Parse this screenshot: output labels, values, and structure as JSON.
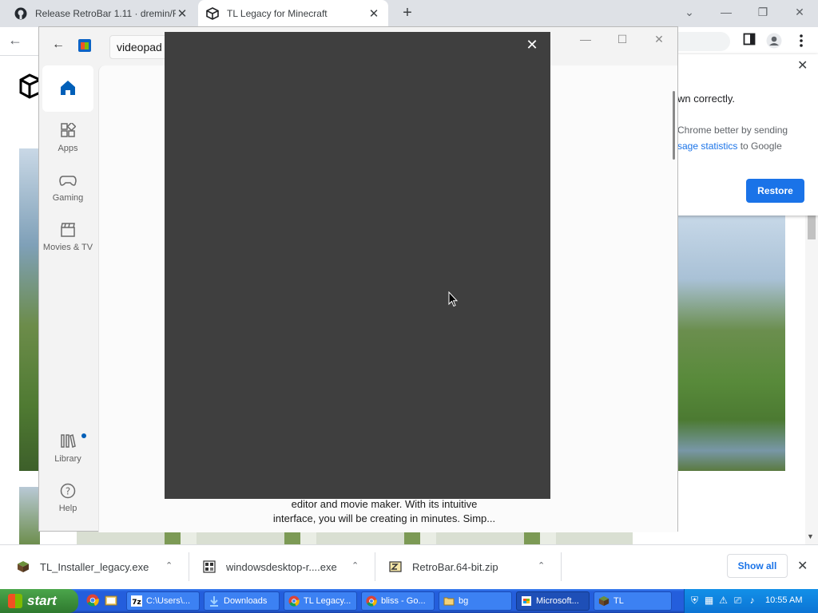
{
  "browser": {
    "tabs": [
      {
        "title": "Release RetroBar 1.11 · dremin/R",
        "icon": "github-icon"
      },
      {
        "title": "TL Legacy for Minecraft",
        "icon": "tl-cube-icon"
      }
    ],
    "new_tab": "+",
    "window_controls": {
      "dropdown": "⌄",
      "minimize": "—",
      "restore": "❐",
      "close": "✕"
    }
  },
  "infobar": {
    "text_line1": "wn correctly.",
    "text_line2": "Chrome better by sending",
    "link": "sage statistics",
    "text_line3_tail": " to Google",
    "restore_label": "Restore",
    "close": "✕"
  },
  "store": {
    "search_value": "videopad",
    "window_controls": {
      "minimize": "—",
      "maximize": "☐",
      "close": "✕"
    },
    "nav": [
      {
        "label": "",
        "icon": "home-icon"
      },
      {
        "label": "Apps",
        "icon": "apps-icon"
      },
      {
        "label": "Gaming",
        "icon": "gamepad-icon"
      },
      {
        "label": "Movies & TV",
        "icon": "clapperboard-icon"
      },
      {
        "label": "Library",
        "icon": "library-icon"
      },
      {
        "label": "Help",
        "icon": "help-icon"
      }
    ],
    "description_line1": "editor and movie maker. With its intuitive",
    "description_line2": "interface, you will be creating in minutes. Simp..."
  },
  "dialog": {
    "close": "✕"
  },
  "downloads": {
    "items": [
      {
        "name": "TL_Installer_legacy.exe",
        "icon": "minecraft-block-icon"
      },
      {
        "name": "windowsdesktop-r....exe",
        "icon": "installer-icon"
      },
      {
        "name": "RetroBar.64-bit.zip",
        "icon": "zip-archive-icon"
      }
    ],
    "chevron": "⌃",
    "show_all": "Show all",
    "close": "✕"
  },
  "taskbar": {
    "start_label": "start",
    "buttons": [
      {
        "label": "C:\\Users\\...",
        "icon": "7zip-icon"
      },
      {
        "label": "Downloads",
        "icon": "download-icon"
      },
      {
        "label": "TL Legacy...",
        "icon": "chrome-icon"
      },
      {
        "label": "bliss - Go...",
        "icon": "chrome-icon"
      },
      {
        "label": "bg",
        "icon": "folder-icon"
      },
      {
        "label": "Microsoft...",
        "icon": "store-icon"
      },
      {
        "label": "TL",
        "icon": "minecraft-block-icon"
      }
    ],
    "clock": "10:55 AM"
  }
}
